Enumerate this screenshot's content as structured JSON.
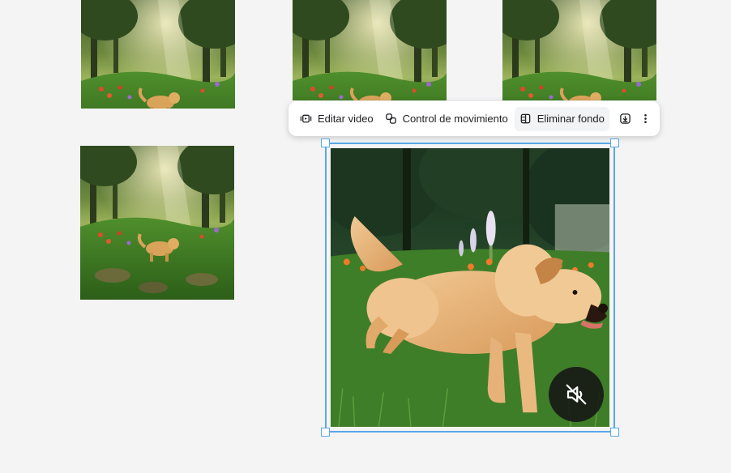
{
  "toolbar": {
    "edit_video_label": "Editar video",
    "motion_control_label": "Control de movimiento",
    "remove_background_label": "Eliminar fondo",
    "download_icon": "download-icon",
    "more_icon": "more-vertical-icon"
  },
  "canvas": {
    "thumbnails": [
      {
        "id": "thumb-1",
        "subject": "golden retriever running in forest meadow"
      },
      {
        "id": "thumb-2",
        "subject": "golden retriever running in forest meadow"
      },
      {
        "id": "thumb-3",
        "subject": "golden retriever running in forest meadow"
      },
      {
        "id": "thumb-4",
        "subject": "golden retriever running in forest meadow"
      }
    ],
    "selected_video": {
      "subject": "golden retriever leaping on grass",
      "muted": true,
      "mute_icon": "volume-off-icon"
    }
  },
  "colors": {
    "background": "#f4f4f5",
    "selection": "#5aa7e6",
    "toolbar_bg": "#ffffff",
    "text": "#202124"
  }
}
